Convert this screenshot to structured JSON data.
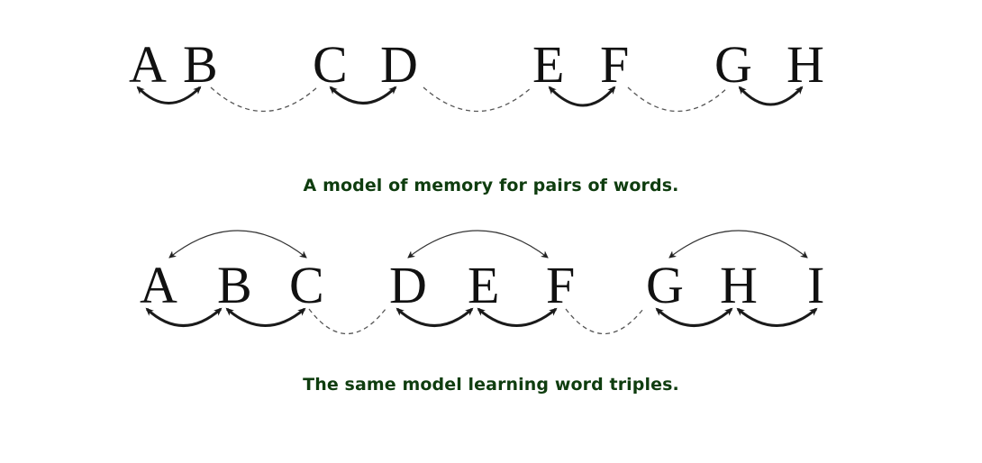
{
  "figure_pairs": {
    "letters": [
      "A",
      "B",
      "C",
      "D",
      "E",
      "F",
      "G",
      "H"
    ],
    "caption": "A model of memory for pairs of words."
  },
  "figure_triples": {
    "letters": [
      "A",
      "B",
      "C",
      "D",
      "E",
      "F",
      "G",
      "H",
      "I"
    ],
    "caption": "The same model learning word triples."
  },
  "colors": {
    "caption": "#0f3d0f",
    "letters": "#111111",
    "strong_link": "#1a1a1a",
    "dashed_link": "#555555"
  }
}
